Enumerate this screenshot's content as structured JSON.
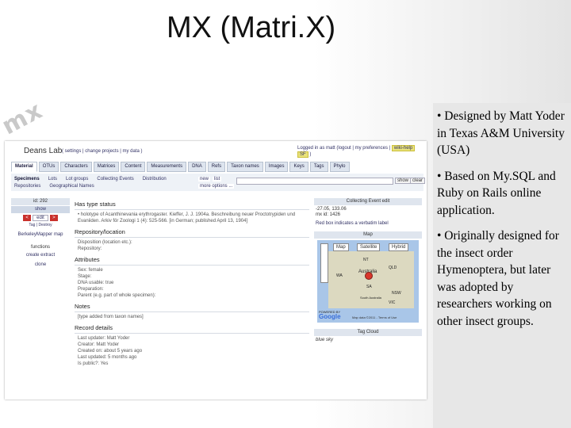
{
  "slide": {
    "title": "MX (Matri.X)",
    "logo": "mx",
    "bullets": [
      "• Designed by Matt Yoder in Texas A&M University (USA)",
      "• Based on My.SQL and Ruby on Rails online application.",
      "• Originally designed for the insect order Hymenoptera, but later was adopted by researchers working on other insect groups."
    ]
  },
  "app": {
    "lab_title": "Deans Lab",
    "lab_links": "( settings | change projects | my data )",
    "user_links": "Logged in as matt (logout | my preferences |",
    "badge_wiki": "wiki-help",
    "badge_sf": "SF",
    "tabs": [
      "Material",
      "OTUs",
      "Characters",
      "Matrices",
      "Content",
      "Measurements",
      "DNA",
      "Refs",
      "Taxon names",
      "Images",
      "Keys",
      "Tags",
      "Phylo"
    ],
    "subnav": [
      "Specimens",
      "Lots",
      "Lot groups",
      "Collecting Events",
      "Distribution",
      "Repositories",
      "Geographical Names"
    ],
    "new": "new",
    "list": "list",
    "more_options": "more options ...",
    "show_btn": "show",
    "clear_btn": "clear",
    "left": {
      "id": "id: 292",
      "show": "show",
      "prev": "<",
      "edit": "edit",
      "next": ">",
      "tag": "Tag",
      "destroy": "Destroy",
      "mapper": "BerkeleyMapper map",
      "functions": "functions",
      "create_extract": "create extract",
      "clone": "clone"
    },
    "sections": {
      "type_status": "Has type status",
      "holotype": "• holotype of Acanthinevania erythrogaster. Kieffer, J. J. 1904a. Beschreibung neuer Proctotrypiden und Evaniiden. Arkiv för Zoologi 1 (4): 525-566. [in German; published April 13, 1904]",
      "repository": "Repository/location",
      "disposition": "Disposition (location etc.):",
      "repo": "Repository:",
      "attributes": "Attributes",
      "sex": "Sex: female",
      "stage": "Stage:",
      "dna": "DNA usable: true",
      "preparation": "Preparation:",
      "parent": "Parent (e.g. part of whole specimen):",
      "notes": "Notes",
      "notes_text": "[type added from taxon names]",
      "record": "Record details",
      "last_updater": "Last updater: Matt Yoder",
      "creator": "Creator: Matt Yoder",
      "created_on": "Created on: about 5 years ago",
      "last_updated": "Last updated: 5 months ago",
      "is_public": "Is public?: Yes"
    },
    "right": {
      "collecting_event": "Collecting Event edit",
      "coords": "-27.05, 133.06",
      "mx_id": "mx id: 1426",
      "red_box": "Red box indicates a verbatim label",
      "map": "Map",
      "map_btn": "Map",
      "satellite_btn": "Satellite",
      "hybrid_btn": "Hybrid",
      "powered": "POWERED BY",
      "google": "Google",
      "terms": "Map data ©2011 - Terms of Use",
      "map_labels": [
        "NT",
        "QLD",
        "WA",
        "Australia",
        "SA",
        "NSW",
        "South Australia",
        "VIC"
      ],
      "tag_cloud": "Tag Cloud",
      "tag": "blue sky"
    }
  }
}
